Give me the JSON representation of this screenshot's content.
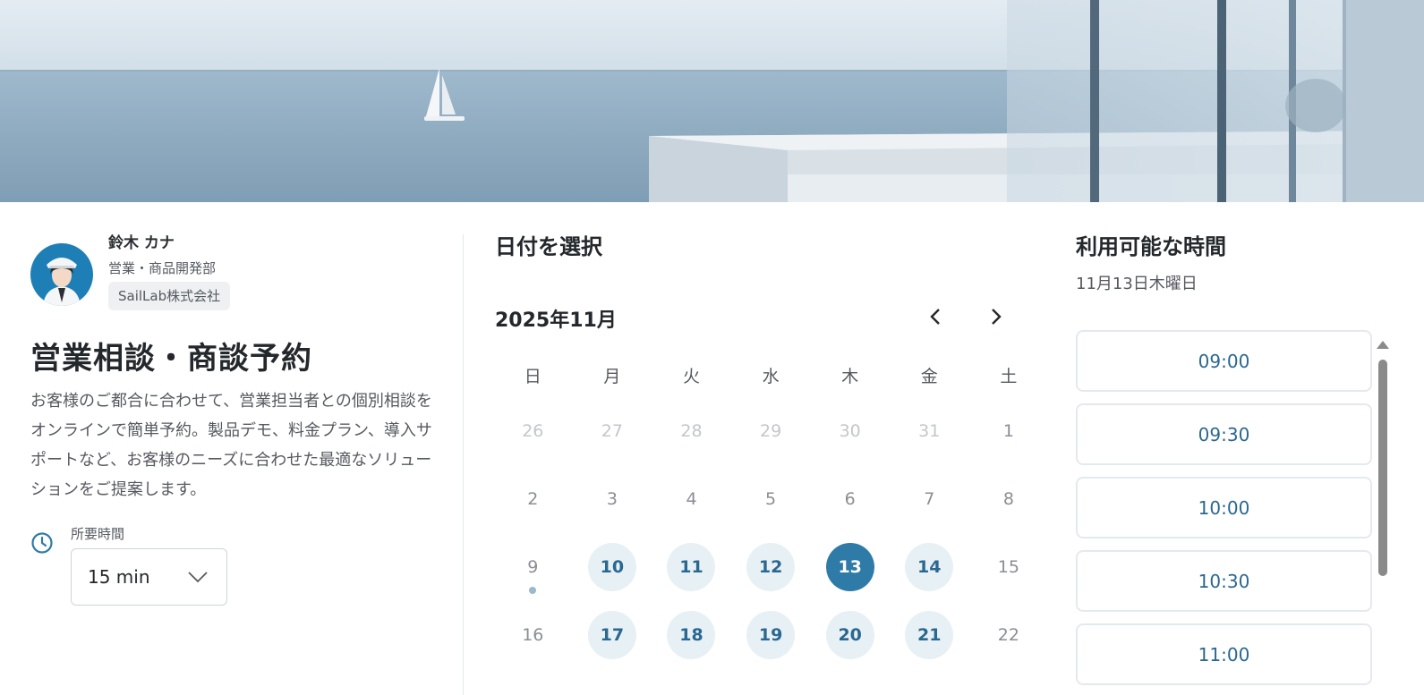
{
  "host": {
    "name": "鈴木 カナ",
    "department": "営業・商品開発部",
    "company": "SailLab株式会社"
  },
  "event": {
    "title": "営業相談・商談予約",
    "description": "お客様のご都合に合わせて、営業担当者との個別相談をオンラインで簡単予約。製品デモ、料金プラン、導入サポートなど、お客様のニーズに合わせた最適なソリューションをご提案します。",
    "duration_label": "所要時間",
    "duration_value": "15 min"
  },
  "calendar": {
    "heading": "日付を選択",
    "month_label": "2025年11月",
    "weekdays": [
      "日",
      "月",
      "火",
      "水",
      "木",
      "金",
      "土"
    ],
    "days": [
      {
        "label": "26",
        "state": "outside"
      },
      {
        "label": "27",
        "state": "outside"
      },
      {
        "label": "28",
        "state": "outside"
      },
      {
        "label": "29",
        "state": "outside"
      },
      {
        "label": "30",
        "state": "outside"
      },
      {
        "label": "31",
        "state": "outside"
      },
      {
        "label": "1",
        "state": "disabled"
      },
      {
        "label": "2",
        "state": "disabled"
      },
      {
        "label": "3",
        "state": "disabled"
      },
      {
        "label": "4",
        "state": "disabled"
      },
      {
        "label": "5",
        "state": "disabled"
      },
      {
        "label": "6",
        "state": "disabled"
      },
      {
        "label": "7",
        "state": "disabled"
      },
      {
        "label": "8",
        "state": "disabled"
      },
      {
        "label": "9",
        "state": "today"
      },
      {
        "label": "10",
        "state": "available"
      },
      {
        "label": "11",
        "state": "available"
      },
      {
        "label": "12",
        "state": "available"
      },
      {
        "label": "13",
        "state": "selected"
      },
      {
        "label": "14",
        "state": "available"
      },
      {
        "label": "15",
        "state": "disabled"
      },
      {
        "label": "16",
        "state": "disabled"
      },
      {
        "label": "17",
        "state": "available"
      },
      {
        "label": "18",
        "state": "available"
      },
      {
        "label": "19",
        "state": "available"
      },
      {
        "label": "20",
        "state": "available"
      },
      {
        "label": "21",
        "state": "available"
      },
      {
        "label": "22",
        "state": "disabled"
      }
    ]
  },
  "times": {
    "heading": "利用可能な時間",
    "selected_date": "11月13日木曜日",
    "slots": [
      "09:00",
      "09:30",
      "10:00",
      "10:30",
      "11:00"
    ]
  },
  "colors": {
    "accent": "#2e7ba7",
    "available_bg": "#e7f0f5",
    "slot_text": "#2a6890"
  }
}
